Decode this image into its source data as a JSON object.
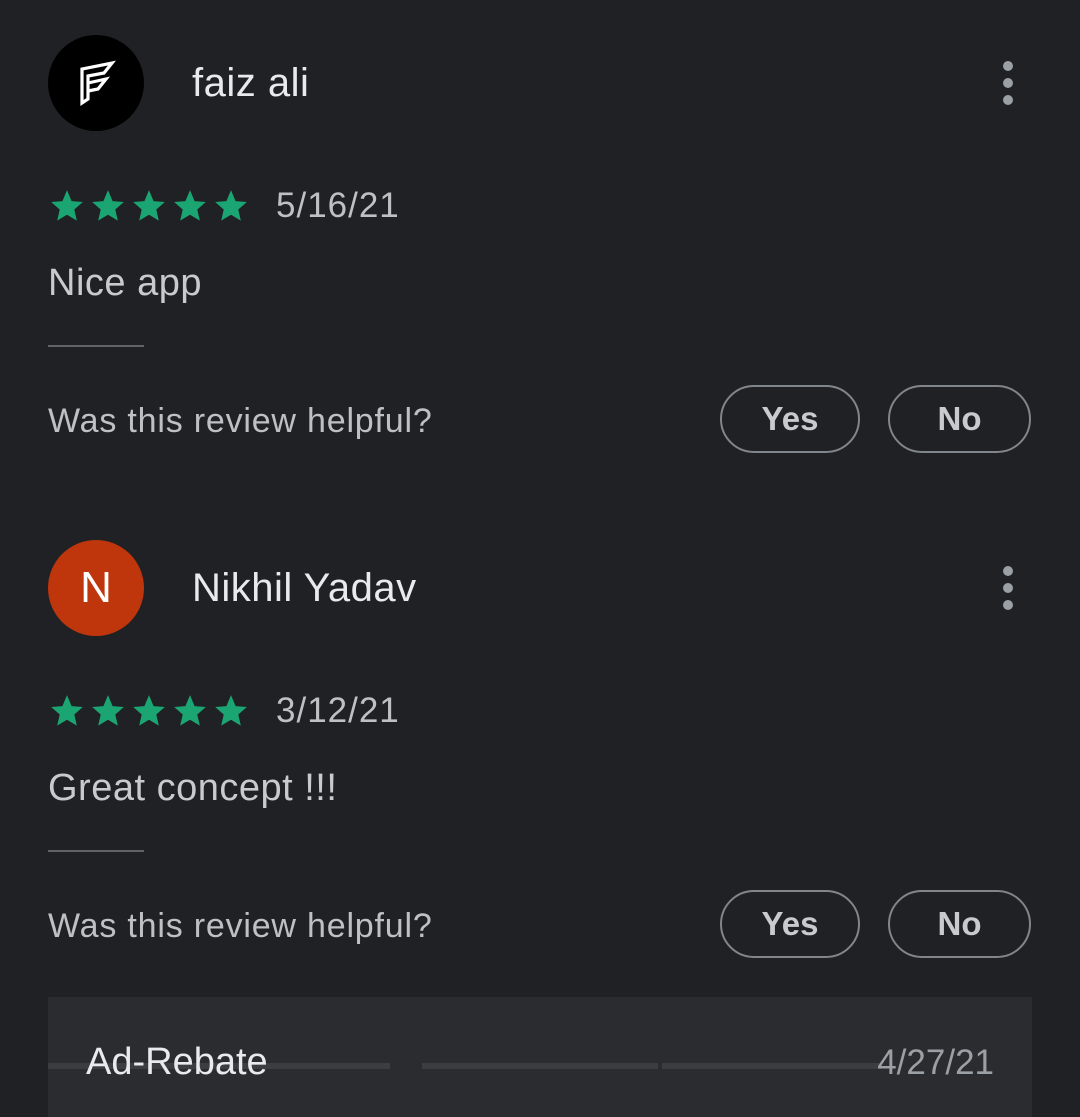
{
  "colors": {
    "background": "#202124",
    "star": "#1aa572",
    "avatar_letter_bg": "#c0360c",
    "avatar_logo_bg": "#000000"
  },
  "reviews": [
    {
      "author": "faiz ali",
      "avatar_type": "logo",
      "avatar_icon": "f-logo-icon",
      "rating": 5,
      "date": "5/16/21",
      "text": "Nice app",
      "helpful_prompt": "Was this review helpful?",
      "yes_label": "Yes",
      "no_label": "No"
    },
    {
      "author": "Nikhil Yadav",
      "avatar_type": "letter",
      "avatar_letter": "N",
      "rating": 5,
      "date": "3/12/21",
      "text": "Great concept !!!",
      "helpful_prompt": "Was this review helpful?",
      "yes_label": "Yes",
      "no_label": "No"
    }
  ],
  "developer_response": {
    "name": "Ad-Rebate",
    "date": "4/27/21"
  }
}
